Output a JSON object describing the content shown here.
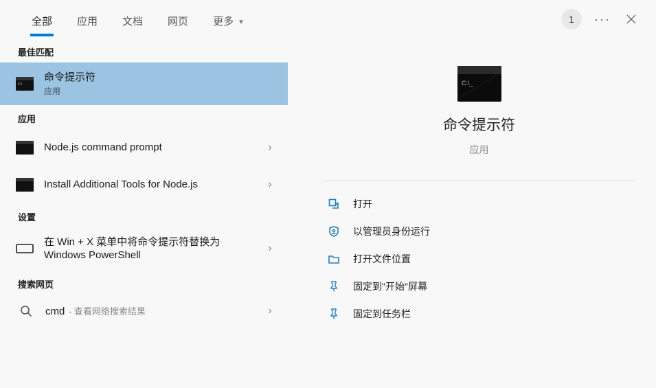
{
  "tabs": {
    "all": "全部",
    "apps": "应用",
    "docs": "文档",
    "web": "网页",
    "more": "更多"
  },
  "title_controls": {
    "badge": "1"
  },
  "sections": {
    "best_match": "最佳匹配",
    "apps": "应用",
    "settings": "设置",
    "search_web": "搜索网页"
  },
  "best_match": {
    "title": "命令提示符",
    "subtitle": "应用"
  },
  "apps_results": [
    {
      "title": "Node.js command prompt"
    },
    {
      "title": "Install Additional Tools for Node.js"
    }
  ],
  "settings_results": [
    {
      "title": "在 Win + X 菜单中将命令提示符替换为 Windows PowerShell"
    }
  ],
  "web_results": {
    "query": "cmd",
    "hint": " - 查看网络搜索结果"
  },
  "preview": {
    "title": "命令提示符",
    "subtitle": "应用"
  },
  "actions": {
    "open": "打开",
    "run_admin": "以管理员身份运行",
    "open_location": "打开文件位置",
    "pin_start": "固定到\"开始\"屏幕",
    "pin_taskbar": "固定到任务栏"
  }
}
